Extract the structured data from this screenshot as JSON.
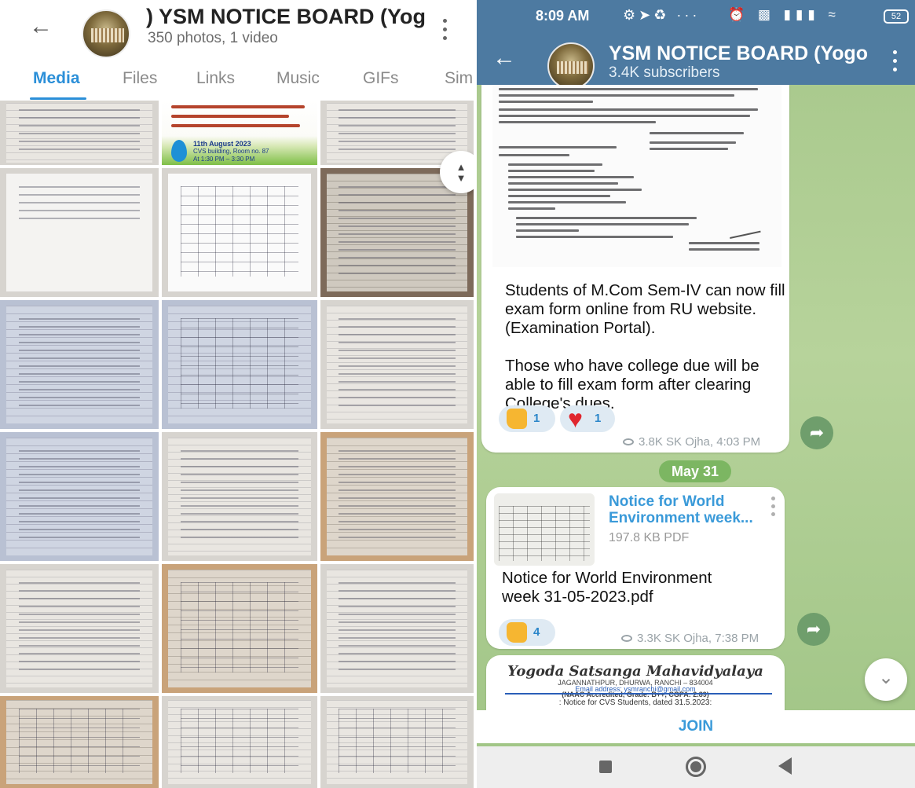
{
  "left": {
    "header": {
      "title": ")   YSM NOTICE BOARD (Yog",
      "subtitle": "350 photos, 1 video"
    },
    "tabs": [
      {
        "label": "Media",
        "active": true
      },
      {
        "label": "Files",
        "active": false
      },
      {
        "label": "Links",
        "active": false
      },
      {
        "label": "Music",
        "active": false
      },
      {
        "label": "GIFs",
        "active": false
      },
      {
        "label": "Simil",
        "active": false
      }
    ],
    "poster": {
      "date_line": "11th August 2023",
      "venue_line": "CVS building, Room no. 87",
      "time_line": "At 1:30 PM – 3:30 PM"
    }
  },
  "right": {
    "status_bar": {
      "time": "8:09 AM",
      "battery": "52"
    },
    "header": {
      "title": "YSM NOTICE BOARD (Yogo",
      "subtitle": "3.4K subscribers"
    },
    "message1": {
      "paragraph1": "Students of M.Com Sem-IV can now fill exam form online from RU website.(Examination Portal).",
      "paragraph2": "Those who have college due will be able to fill exam form after clearing College's dues.",
      "reactions": [
        {
          "emoji": "thumbs-up",
          "count": "1"
        },
        {
          "emoji": "heart",
          "count": "1"
        }
      ],
      "meta": "3.8K  SK Ojha, 4:03 PM"
    },
    "date_separator": "May 31",
    "message2": {
      "file_name": "Notice for World Environment week...",
      "file_size": "197.8 KB PDF",
      "caption": "Notice for World Environment week 31-05-2023.pdf",
      "reactions": [
        {
          "emoji": "thumbs-up",
          "count": "4"
        }
      ],
      "meta": "3.3K  SK Ojha, 7:38 PM"
    },
    "message3": {
      "college_name": "Yogoda Satsanga Mahavidyalaya",
      "address": "JAGANNATHPUR, DHURWA, RANCHI – 834004",
      "email": "Email address: ysmranchi@gmail.com",
      "accreditation": "(NAAC Accredited, Grade: B++, CGPA: 2.89)",
      "notice_line": ": Notice for CVS Students, dated 31.5.2023:"
    },
    "join_label": "JOIN"
  }
}
